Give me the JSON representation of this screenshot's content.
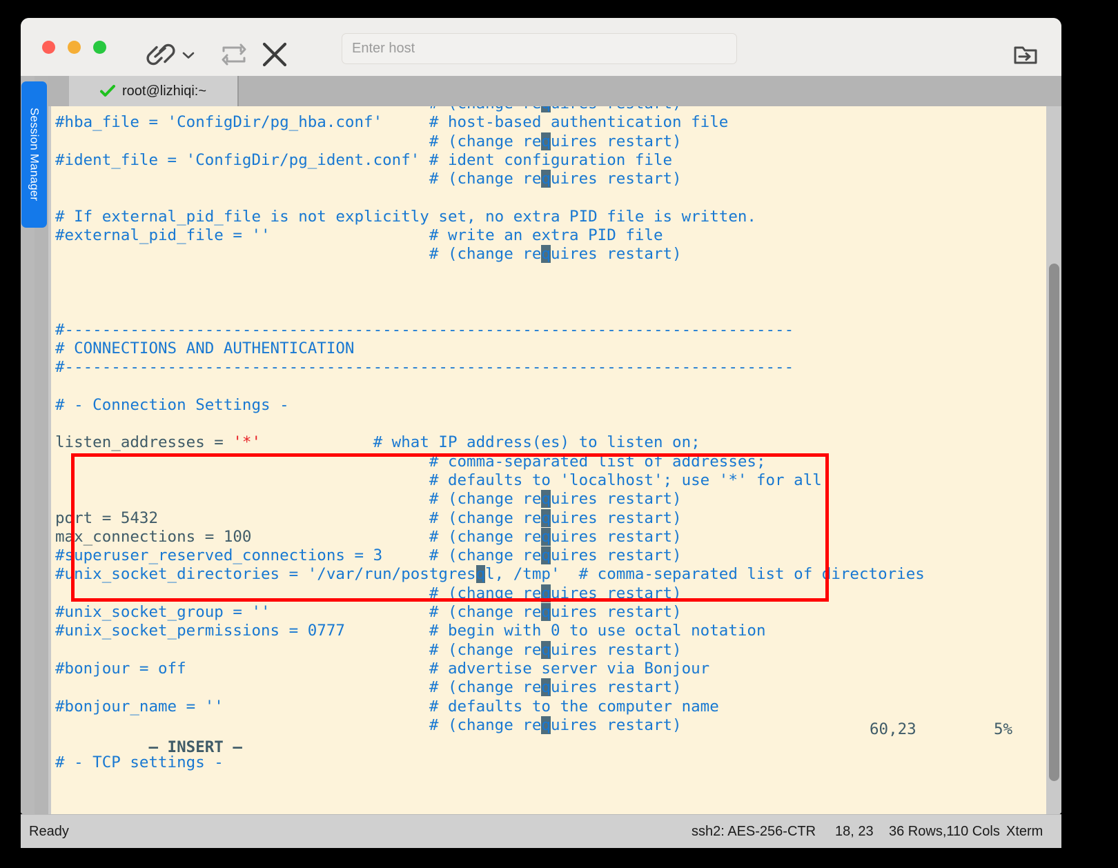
{
  "window": {
    "traffic_lights": [
      "close",
      "minimize",
      "zoom"
    ],
    "colors": {
      "accent_blue": "#1479ea",
      "terminal_bg": "#fdf3da",
      "comment_blue": "#1878d2",
      "plain_slate": "#3f5b68",
      "string_red": "#e8252a",
      "annotation_red": "#ff0000",
      "column_highlight": "#4e6d7d"
    }
  },
  "toolbar": {
    "connect_label": "link-icon",
    "connect_caret_label": "chevron-down-icon",
    "reconnect_label": "reconnect-icon",
    "disconnect_label": "close-icon",
    "transfer_label": "file-transfer-icon",
    "host_input": {
      "value": "",
      "placeholder": "Enter host"
    }
  },
  "sidebar": {
    "session_manager_label": "Session Manager"
  },
  "tabs": [
    {
      "label": "root@lizhiqi:~",
      "status_icon": "check-icon",
      "active": true
    }
  ],
  "terminal": {
    "rows": 36,
    "cols": 110,
    "lines": [
      [
        {
          "t": "                                        # (change re",
          "c": "comment"
        },
        {
          "t": "q",
          "c": "hl"
        },
        {
          "t": "uires restart)",
          "c": "comment"
        }
      ],
      [
        {
          "t": "#hba_file = 'ConfigDir/pg_hba.conf'     # host-based authentication file",
          "c": "comment"
        }
      ],
      [
        {
          "t": "                                        # (change re",
          "c": "comment"
        },
        {
          "t": "q",
          "c": "hl"
        },
        {
          "t": "uires restart)",
          "c": "comment"
        }
      ],
      [
        {
          "t": "#ident_file = 'ConfigDir/pg_ident.conf' # ident configuration file",
          "c": "comment"
        }
      ],
      [
        {
          "t": "                                        # (change re",
          "c": "comment"
        },
        {
          "t": "q",
          "c": "hl"
        },
        {
          "t": "uires restart)",
          "c": "comment"
        }
      ],
      [
        {
          "t": "",
          "c": "comment"
        }
      ],
      [
        {
          "t": "# If external_pid_file is not explicitly set, no extra PID file is written.",
          "c": "comment"
        }
      ],
      [
        {
          "t": "#external_pid_file = ''                 # write an extra PID file",
          "c": "comment"
        }
      ],
      [
        {
          "t": "                                        # (change re",
          "c": "comment"
        },
        {
          "t": "q",
          "c": "hl"
        },
        {
          "t": "uires restart)",
          "c": "comment"
        }
      ],
      [
        {
          "t": "",
          "c": "comment"
        }
      ],
      [
        {
          "t": "",
          "c": "comment"
        }
      ],
      [
        {
          "t": "",
          "c": "comment"
        }
      ],
      [
        {
          "t": "#------------------------------------------------------------------------------",
          "c": "comment"
        }
      ],
      [
        {
          "t": "# CONNECTIONS AND AUTHENTICATION",
          "c": "comment"
        }
      ],
      [
        {
          "t": "#------------------------------------------------------------------------------",
          "c": "comment"
        }
      ],
      [
        {
          "t": "",
          "c": "comment"
        }
      ],
      [
        {
          "t": "# - Connection Settings -",
          "c": "comment"
        }
      ],
      [
        {
          "t": "",
          "c": "comment"
        }
      ],
      [
        {
          "t": "listen_addresses = ",
          "c": "plain"
        },
        {
          "t": "'*'",
          "c": "string"
        },
        {
          "t": "            # what IP address(es) to listen on;",
          "c": "comment"
        }
      ],
      [
        {
          "t": "                                        # comma-separated list of addresses;",
          "c": "comment"
        }
      ],
      [
        {
          "t": "                                        # defaults to 'localhost'; use '*' for all",
          "c": "comment"
        }
      ],
      [
        {
          "t": "                                        # (change re",
          "c": "comment"
        },
        {
          "t": "q",
          "c": "hl"
        },
        {
          "t": "uires restart)",
          "c": "comment"
        }
      ],
      [
        {
          "t": "port = 5432                             ",
          "c": "plain"
        },
        {
          "t": "# (change re",
          "c": "comment"
        },
        {
          "t": "q",
          "c": "hl"
        },
        {
          "t": "uires restart)",
          "c": "comment"
        }
      ],
      [
        {
          "t": "max_connections = 100                   ",
          "c": "plain"
        },
        {
          "t": "# (change re",
          "c": "comment"
        },
        {
          "t": "q",
          "c": "hl"
        },
        {
          "t": "uires restart)",
          "c": "comment"
        }
      ],
      [
        {
          "t": "#superuser_reserved_connections = 3     # (change re",
          "c": "comment"
        },
        {
          "t": "q",
          "c": "hl"
        },
        {
          "t": "uires restart)",
          "c": "comment"
        }
      ],
      [
        {
          "t": "#unix_socket_directories = '/var/run/postgres",
          "c": "comment"
        },
        {
          "t": "q",
          "c": "hl"
        },
        {
          "t": "l, /tmp'  # comma-separated list of directories",
          "c": "comment"
        }
      ],
      [
        {
          "t": "                                        # (change re",
          "c": "comment"
        },
        {
          "t": "q",
          "c": "hl"
        },
        {
          "t": "uires restart)",
          "c": "comment"
        }
      ],
      [
        {
          "t": "#unix_socket_group = ''                 # (change re",
          "c": "comment"
        },
        {
          "t": "q",
          "c": "hl"
        },
        {
          "t": "uires restart)",
          "c": "comment"
        }
      ],
      [
        {
          "t": "#unix_socket_permissions = 0777         # begin with 0 to use octal notation",
          "c": "comment"
        }
      ],
      [
        {
          "t": "                                        # (change re",
          "c": "comment"
        },
        {
          "t": "q",
          "c": "hl"
        },
        {
          "t": "uires restart)",
          "c": "comment"
        }
      ],
      [
        {
          "t": "#bonjour = off                          # advertise server via Bonjour",
          "c": "comment"
        }
      ],
      [
        {
          "t": "                                        # (change re",
          "c": "comment"
        },
        {
          "t": "q",
          "c": "hl"
        },
        {
          "t": "uires restart)",
          "c": "comment"
        }
      ],
      [
        {
          "t": "#bonjour_name = ''                      # defaults to the computer name",
          "c": "comment"
        }
      ],
      [
        {
          "t": "                                        # (change re",
          "c": "comment"
        },
        {
          "t": "q",
          "c": "hl"
        },
        {
          "t": "uires restart)",
          "c": "comment"
        }
      ],
      [
        {
          "t": "",
          "c": "comment"
        }
      ],
      [
        {
          "t": "# - TCP settings -",
          "c": "comment"
        }
      ]
    ],
    "vim_status": {
      "mode": "— INSERT —",
      "position": "60,23",
      "percent": "5%"
    }
  },
  "annotation": {
    "label": "red-highlight-box"
  },
  "statusbar": {
    "ready": "Ready",
    "cipher": "ssh2: AES-256-CTR",
    "coords": "18, 23",
    "size": "36 Rows,110 Cols",
    "terminal_type": "Xterm"
  }
}
